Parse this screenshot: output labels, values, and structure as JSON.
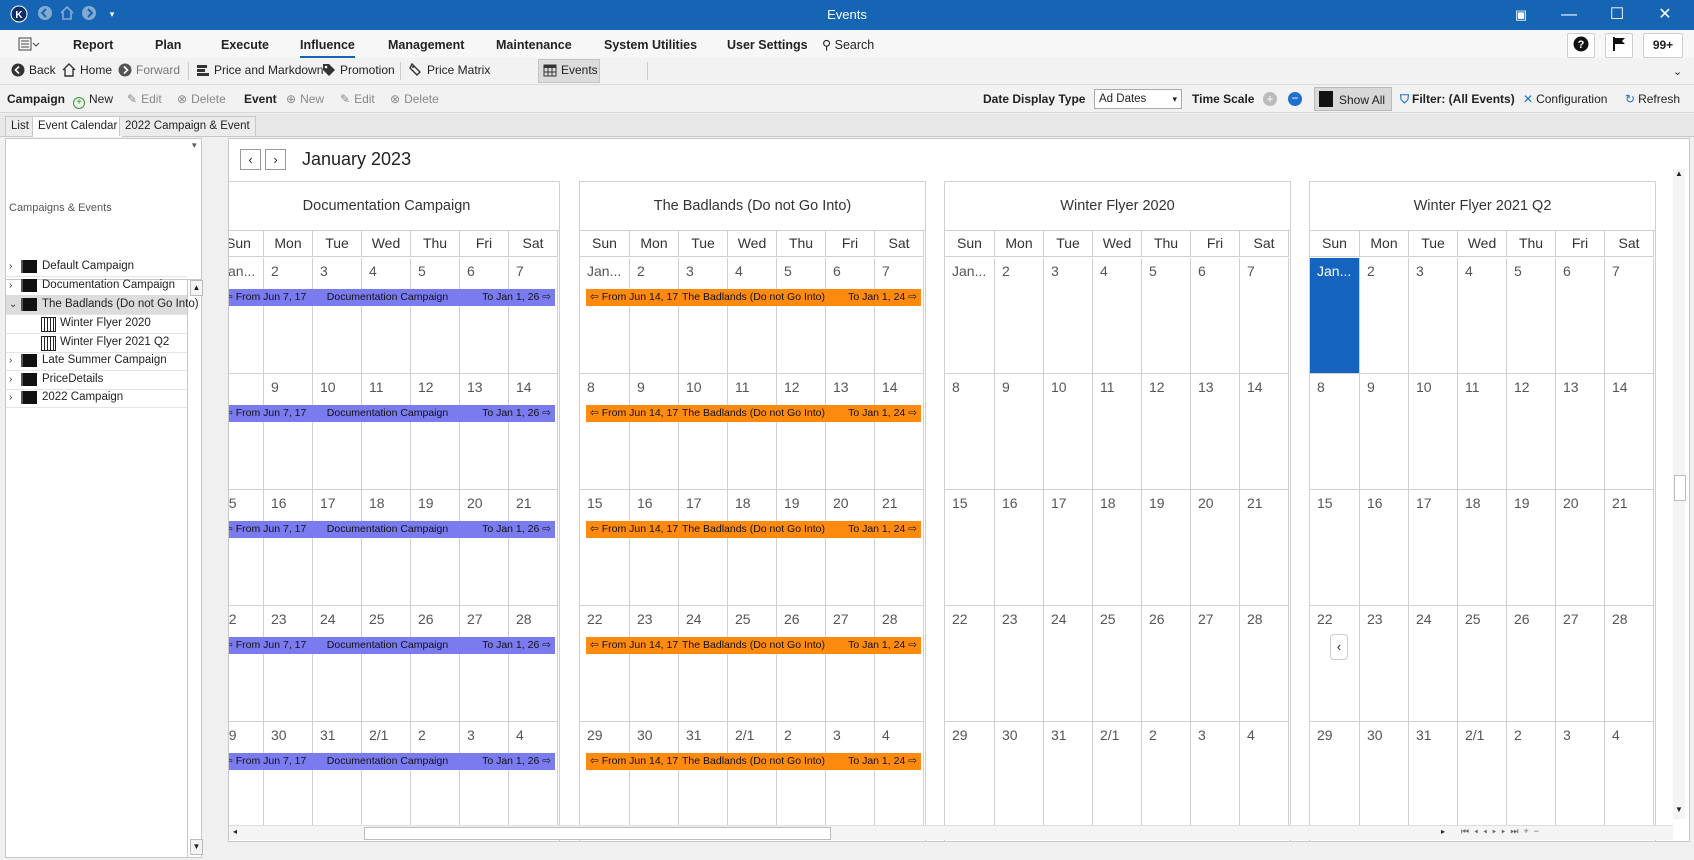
{
  "window": {
    "title": "Events",
    "notifications": "99+"
  },
  "menu": {
    "items": [
      "Report",
      "Plan",
      "Execute",
      "Influence",
      "Management",
      "Maintenance",
      "System Utilities",
      "User Settings"
    ],
    "search": "Search",
    "active": "Influence"
  },
  "nav": {
    "back": "Back",
    "home": "Home",
    "forward": "Forward",
    "price_markdown": "Price and Markdown",
    "promotion": "Promotion",
    "price_matrix": "Price Matrix",
    "events": "Events"
  },
  "commands": {
    "campaign": "Campaign",
    "new": "New",
    "edit": "Edit",
    "delete": "Delete",
    "event": "Event",
    "event_new": "New",
    "event_edit": "Edit",
    "event_delete": "Delete",
    "date_display_type_label": "Date Display Type",
    "date_display_type_value": "Ad Dates",
    "time_scale": "Time Scale",
    "show_all": "Show All",
    "filter": "Filter: (All Events)",
    "configuration": "Configuration",
    "refresh": "Refresh"
  },
  "tabs": [
    "List",
    "Event Calendar",
    "2022 Campaign & Event"
  ],
  "left_panel": {
    "header": "Campaigns & Events",
    "tree": [
      {
        "label": "Default Campaign",
        "type": "campaign",
        "expanded": false
      },
      {
        "label": "Documentation Campaign",
        "type": "campaign",
        "expanded": false
      },
      {
        "label": "The Badlands (Do not Go Into)",
        "type": "campaign",
        "expanded": true
      },
      {
        "label": "Winter Flyer 2020",
        "type": "event"
      },
      {
        "label": "Winter Flyer 2021 Q2",
        "type": "event"
      },
      {
        "label": "Late Summer Campaign",
        "type": "campaign",
        "expanded": false
      },
      {
        "label": "PriceDetails",
        "type": "campaign",
        "expanded": false
      },
      {
        "label": "2022 Campaign",
        "type": "campaign",
        "expanded": false
      }
    ]
  },
  "calendar": {
    "month": "January 2023",
    "days_of_week": [
      "Sun",
      "Mon",
      "Tue",
      "Wed",
      "Thu",
      "Fri",
      "Sat"
    ],
    "weeks": [
      [
        "Jan...",
        "2",
        "3",
        "4",
        "5",
        "6",
        "7"
      ],
      [
        "8",
        "9",
        "10",
        "11",
        "12",
        "13",
        "14"
      ],
      [
        "15",
        "16",
        "17",
        "18",
        "19",
        "20",
        "21"
      ],
      [
        "22",
        "23",
        "24",
        "25",
        "26",
        "27",
        "28"
      ],
      [
        "29",
        "30",
        "31",
        "2/1",
        "2",
        "3",
        "4"
      ]
    ],
    "resources": [
      {
        "name": "Documentation Campaign",
        "event": {
          "from": "From Jun 7, 17",
          "title": "Documentation Campaign",
          "to": "To Jan 1, 26",
          "color": "#7b7bf0"
        }
      },
      {
        "name": "The Badlands (Do not Go Into)",
        "event": {
          "from": "From Jun 14, 17",
          "title": "The Badlands (Do not Go Into)",
          "to": "To Jan 1, 24",
          "color": "#ff8a10"
        }
      },
      {
        "name": "Winter Flyer 2020",
        "event": null
      },
      {
        "name": "Winter Flyer 2021 Q2",
        "event": null,
        "today_cell": "Jan..."
      }
    ]
  }
}
